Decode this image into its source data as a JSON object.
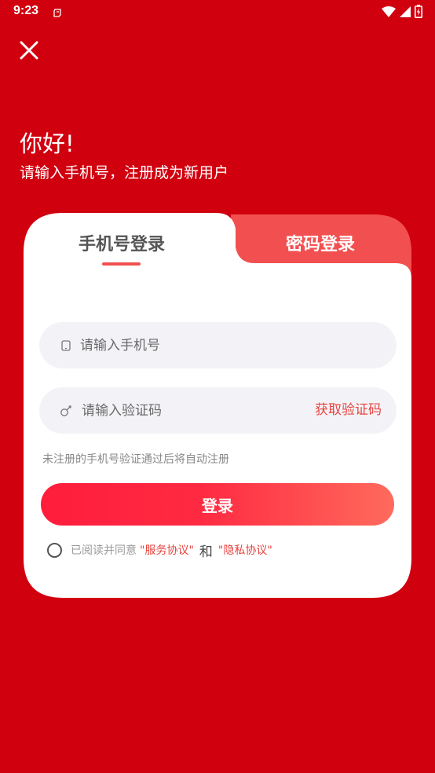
{
  "status_bar": {
    "time": "9:23"
  },
  "greeting": {
    "title": "你好!",
    "subtitle": "请输入手机号，注册成为新用户"
  },
  "tabs": {
    "phone_login": "手机号登录",
    "password_login": "密码登录"
  },
  "phone_field": {
    "placeholder": "请输入手机号"
  },
  "code_field": {
    "placeholder": "请输入验证码",
    "get_code_label": "获取验证码"
  },
  "hint": "未注册的手机号验证通过后将自动注册",
  "login_button": "登录",
  "agreement": {
    "prefix": "已阅读并同意",
    "service_link": "\"服务协议\"",
    "and": "和",
    "privacy_link": "\"隐私协议\""
  },
  "colors": {
    "background": "#d1000f",
    "accent": "#f25050",
    "link": "#e8443f"
  }
}
